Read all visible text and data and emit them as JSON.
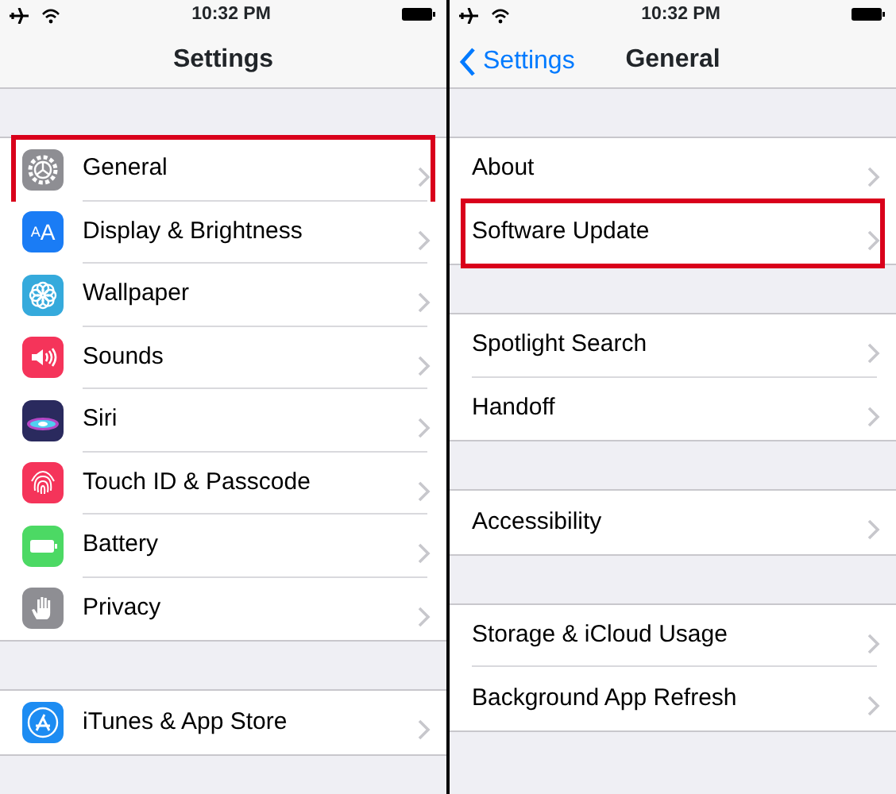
{
  "panes": [
    {
      "status_bar": {
        "time": "10:32 PM"
      },
      "nav": {
        "title": "Settings"
      },
      "groups": [
        {
          "items": [
            {
              "label": "General",
              "kind": "gear",
              "color": "#8e8e93",
              "highlighted": true
            },
            {
              "label": "Display & Brightness",
              "kind": "text",
              "icon_text": "AA",
              "color": "#1a7cf5",
              "highlighted": false
            },
            {
              "label": "Wallpaper",
              "kind": "flower",
              "color": "#35aadc",
              "highlighted": false
            },
            {
              "label": "Sounds",
              "kind": "speaker",
              "color": "#f5345a",
              "highlighted": false
            },
            {
              "label": "Siri",
              "kind": "orb",
              "color": "#2a2a5e",
              "highlighted": false
            },
            {
              "label": "Touch ID & Passcode",
              "kind": "fingerprint",
              "color": "#f5345a",
              "highlighted": false
            },
            {
              "label": "Battery",
              "kind": "battery",
              "color": "#4cd964",
              "highlighted": false
            },
            {
              "label": "Privacy",
              "kind": "hand",
              "color": "#8e8e93",
              "highlighted": false
            }
          ]
        },
        {
          "items": [
            {
              "label": "iTunes & App Store",
              "kind": "appstore",
              "color": "#1d8cf2",
              "highlighted": false
            }
          ]
        }
      ]
    },
    {
      "status_bar": {
        "time": "10:32 PM"
      },
      "nav": {
        "back": "Settings",
        "title": "General"
      },
      "groups": [
        {
          "items": [
            {
              "label": "About",
              "highlighted": false
            },
            {
              "label": "Software Update",
              "highlighted": true
            }
          ]
        },
        {
          "items": [
            {
              "label": "Spotlight Search",
              "highlighted": false
            },
            {
              "label": "Handoff",
              "highlighted": false
            }
          ]
        },
        {
          "items": [
            {
              "label": "Accessibility",
              "highlighted": false
            }
          ]
        },
        {
          "items": [
            {
              "label": "Storage & iCloud Usage",
              "highlighted": false
            },
            {
              "label": "Background App Refresh",
              "highlighted": false
            }
          ]
        }
      ]
    }
  ]
}
